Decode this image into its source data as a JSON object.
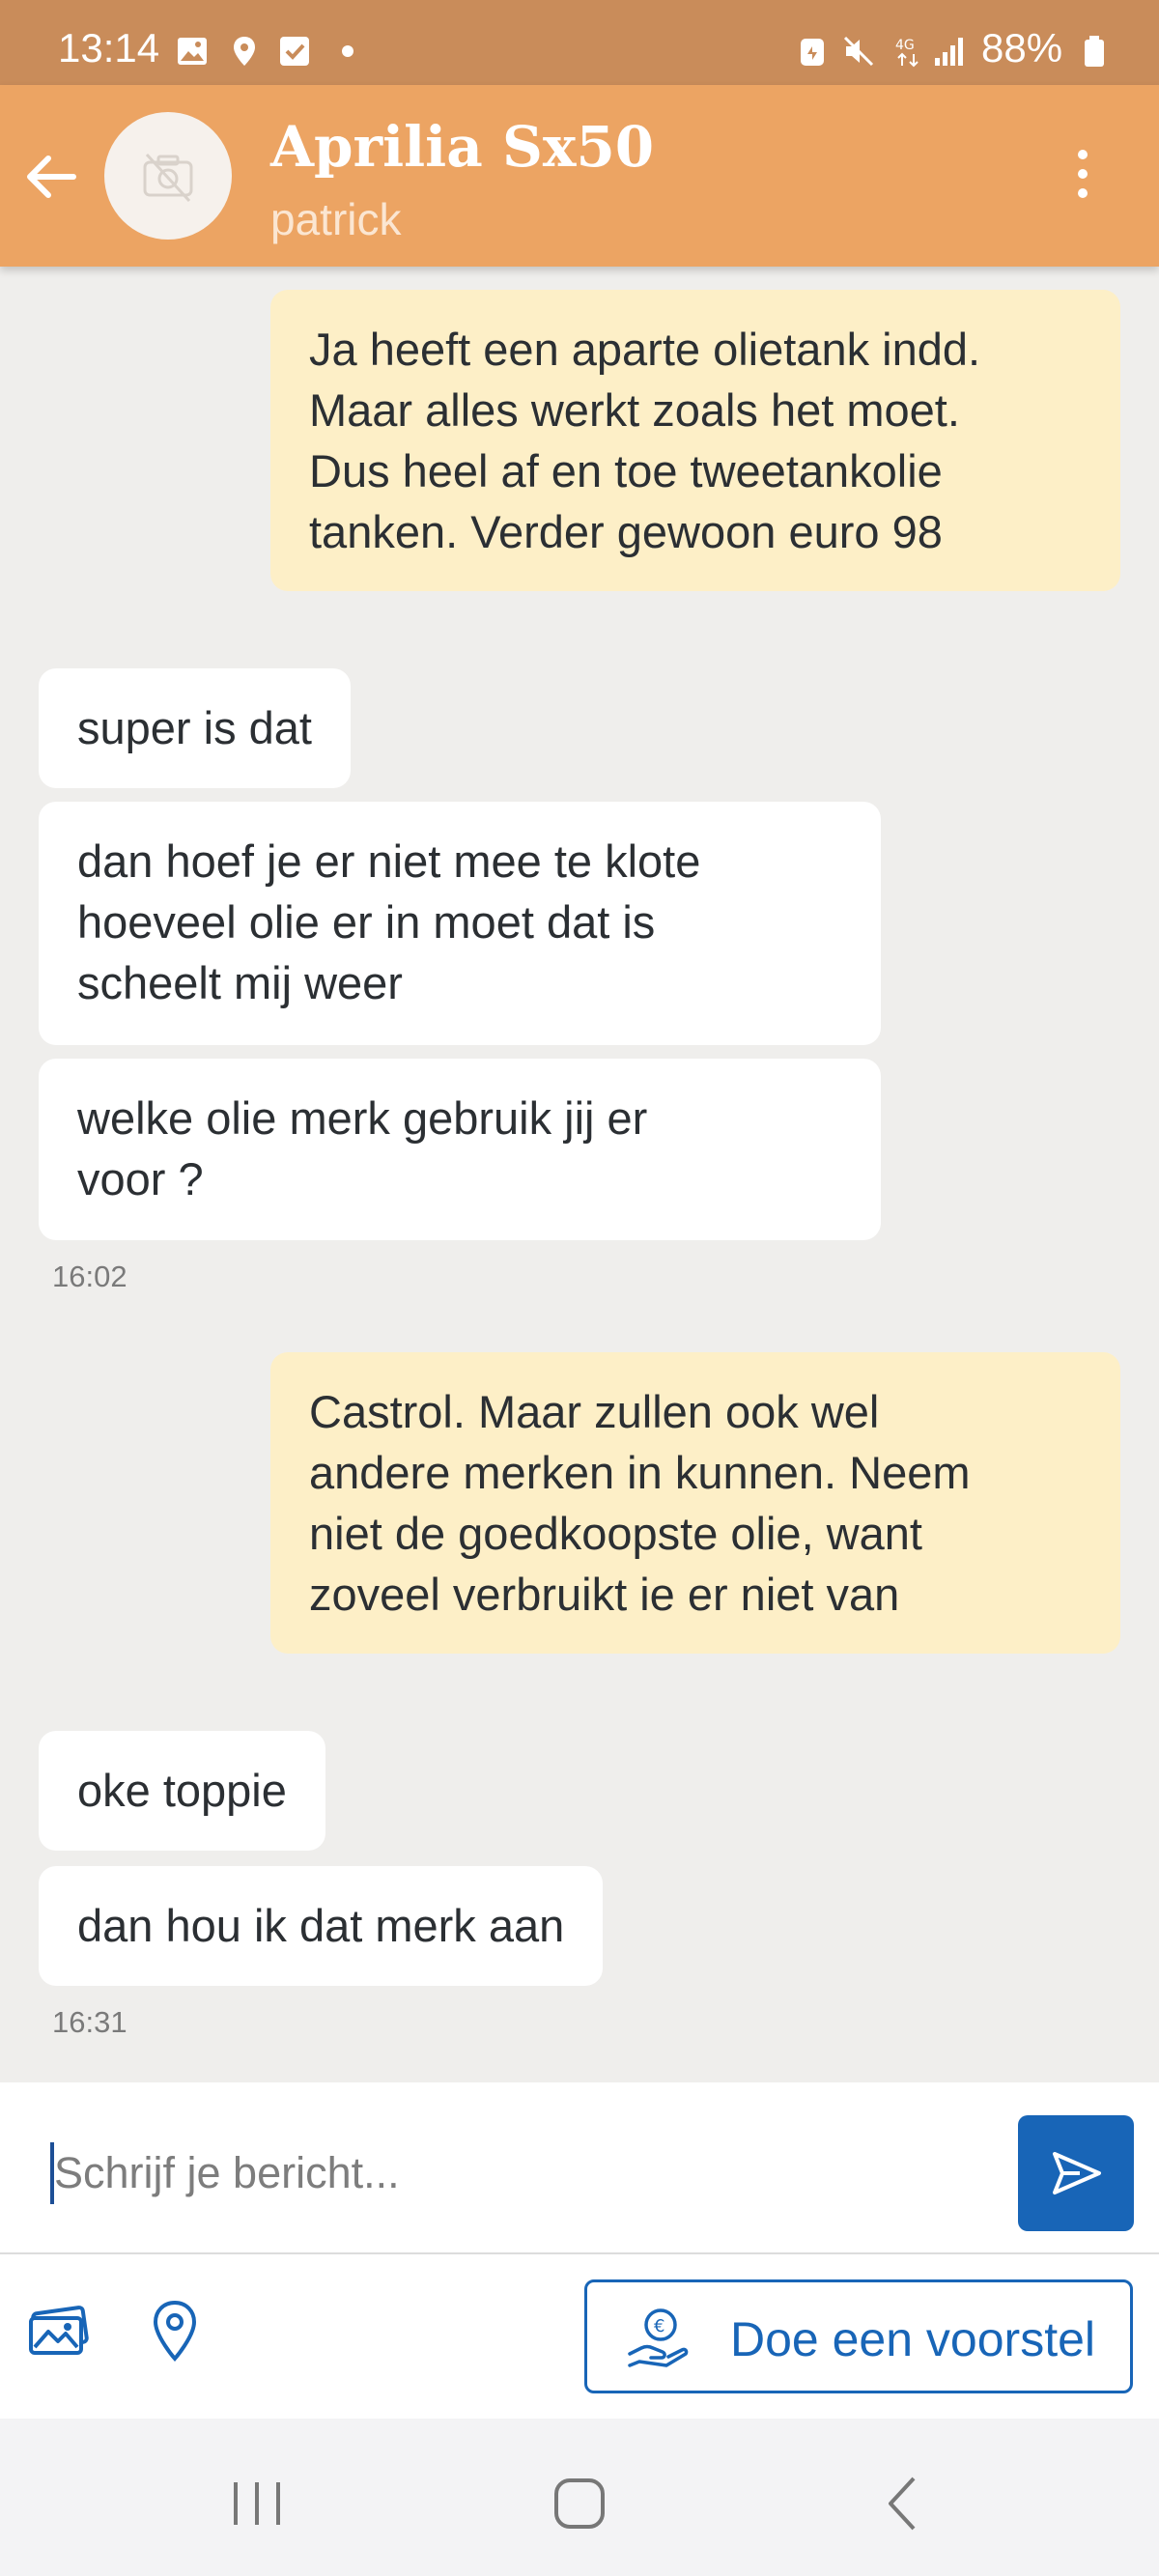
{
  "status_bar": {
    "time": "13:14",
    "battery": "88%"
  },
  "header": {
    "title": "Aprilia Sx50",
    "subtitle": "patrick"
  },
  "messages": [
    {
      "type": "sent",
      "text": "Ja heeft een aparte olietank indd.\nMaar alles werkt zoals het moet.\nDus heel af en toe tweetankolie\ntanken. Verder gewoon euro 98"
    },
    {
      "type": "received",
      "text": "super is dat"
    },
    {
      "type": "received",
      "text": "dan hoef je er niet mee te klote\nhoeveel olie er in moet dat is\nscheelt mij weer"
    },
    {
      "type": "received",
      "text": "welke olie merk gebruik jij er\nvoor ?"
    },
    {
      "type": "timestamp",
      "text": "16:02"
    },
    {
      "type": "sent",
      "text": "Castrol. Maar zullen ook wel\nandere merken in kunnen. Neem\nniet de goedkoopste olie, want\nzoveel verbruikt ie er niet van"
    },
    {
      "type": "received",
      "text": "oke  toppie"
    },
    {
      "type": "received",
      "text": "dan hou ik dat merk aan"
    },
    {
      "type": "timestamp",
      "text": "16:31"
    }
  ],
  "composer": {
    "placeholder": "Schrijf je bericht...",
    "value": ""
  },
  "toolbar": {
    "offer_label": "Doe een voorstel"
  },
  "colors": {
    "header": "#eca463",
    "status_bar": "#c98c5a",
    "sent_bubble": "#fdefc7",
    "received_bubble": "#ffffff",
    "accent": "#1865b7",
    "background": "#efeeec"
  },
  "icons": {
    "status": [
      "gallery-icon",
      "location-icon",
      "check-icon",
      "dot-icon",
      "battery-saver-icon",
      "mute-icon",
      "4g-icon",
      "signal-icon",
      "battery-icon"
    ],
    "header": [
      "back-arrow-icon",
      "no-photo-icon",
      "more-vertical-icon"
    ],
    "composer": [
      "send-icon"
    ],
    "toolbar": [
      "photos-icon",
      "location-pin-icon",
      "euro-hand-icon"
    ],
    "nav": [
      "recents-icon",
      "home-icon",
      "back-icon"
    ]
  }
}
